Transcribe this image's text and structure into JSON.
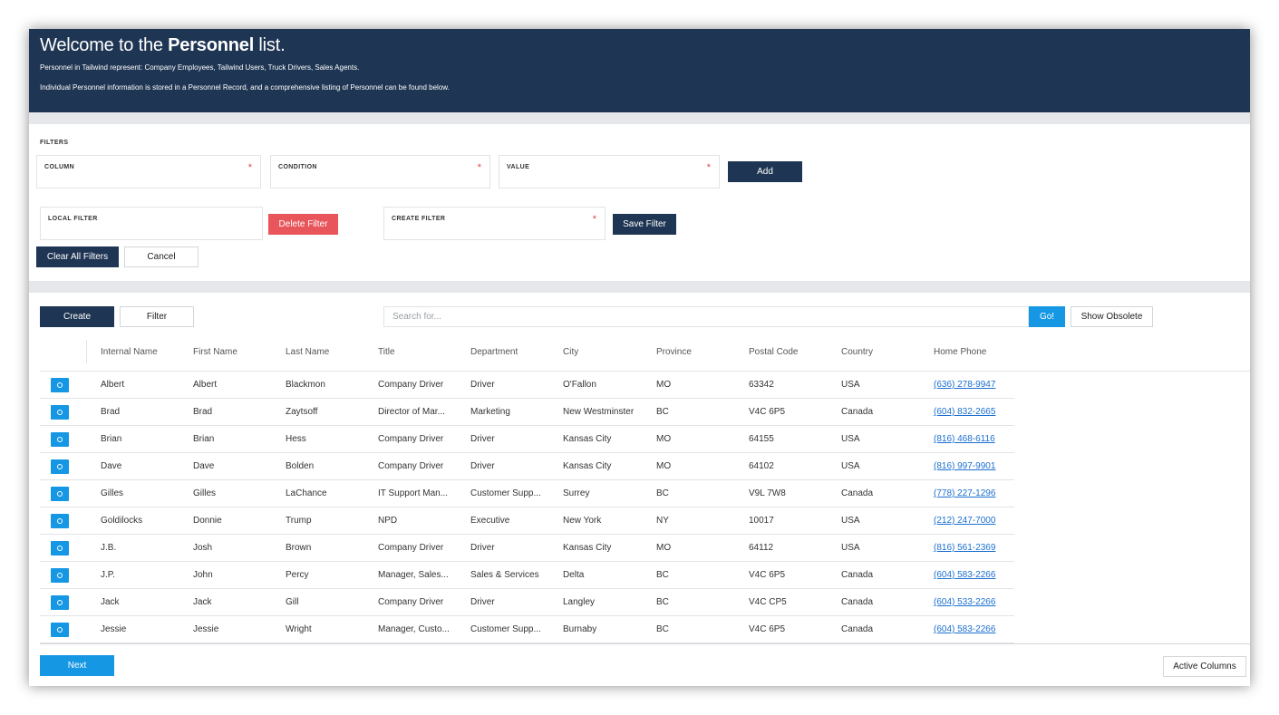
{
  "banner": {
    "title_prefix": "Welcome to the ",
    "title_bold": "Personnel",
    "title_suffix": " list.",
    "line1": "Personnel in Tailwind represent: Company Employees, Tailwind Users, Truck Drivers, Sales Agents.",
    "line2": "Individual Personnel information is stored in a Personnel Record, and a comprehensive listing of Personnel can be found below."
  },
  "filters": {
    "heading": "FILTERS",
    "column_label": "COLUMN",
    "condition_label": "CONDITION",
    "value_label": "VALUE",
    "required_mark": "*",
    "add_label": "Add",
    "local_filter_label": "LOCAL FILTER",
    "delete_filter_label": "Delete Filter",
    "create_filter_label": "CREATE FILTER",
    "save_filter_label": "Save Filter",
    "clear_all_label": "Clear All Filters",
    "cancel_label": "Cancel"
  },
  "toolbar": {
    "create_label": "Create",
    "filter_label": "Filter",
    "search_placeholder": "Search for...",
    "go_label": "Go!",
    "show_obsolete_label": "Show Obsolete"
  },
  "table": {
    "columns": [
      "Internal Name",
      "First Name",
      "Last Name",
      "Title",
      "Department",
      "City",
      "Province",
      "Postal Code",
      "Country",
      "Home Phone"
    ],
    "rows": [
      [
        "Albert",
        "Albert",
        "Blackmon",
        "Company Driver",
        "Driver",
        "O'Fallon",
        "MO",
        "63342",
        "USA",
        "(636) 278-9947"
      ],
      [
        "Brad",
        "Brad",
        "Zaytsoff",
        "Director of Mar...",
        "Marketing",
        "New Westminster",
        "BC",
        "V4C 6P5",
        "Canada",
        "(604) 832-2665"
      ],
      [
        "Brian",
        "Brian",
        "Hess",
        "Company Driver",
        "Driver",
        "Kansas City",
        "MO",
        "64155",
        "USA",
        "(816) 468-6116"
      ],
      [
        "Dave",
        "Dave",
        "Bolden",
        "Company Driver",
        "Driver",
        "Kansas City",
        "MO",
        "64102",
        "USA",
        "(816) 997-9901"
      ],
      [
        "Gilles",
        "Gilles",
        "LaChance",
        "IT Support Man...",
        "Customer Supp...",
        "Surrey",
        "BC",
        "V9L 7W8",
        "Canada",
        "(778) 227-1296"
      ],
      [
        "Goldilocks",
        "Donnie",
        "Trump",
        "NPD",
        "Executive",
        "New York",
        "NY",
        "10017",
        "USA",
        "(212) 247-7000"
      ],
      [
        "J.B.",
        "Josh",
        "Brown",
        "Company Driver",
        "Driver",
        "Kansas City",
        "MO",
        "64112",
        "USA",
        "(816) 561-2369"
      ],
      [
        "J.P.",
        "John",
        "Percy",
        "Manager, Sales...",
        "Sales & Services",
        "Delta",
        "BC",
        "V4C 6P5",
        "Canada",
        "(604) 583-2266"
      ],
      [
        "Jack",
        "Jack",
        "Gill",
        "Company Driver",
        "Driver",
        "Langley",
        "BC",
        "V4C CP5",
        "Canada",
        "(604) 533-2266"
      ],
      [
        "Jessie",
        "Jessie",
        "Wright",
        "Manager, Custo...",
        "Customer Supp...",
        "Burnaby",
        "BC",
        "V4C 6P5",
        "Canada",
        "(604) 583-2266"
      ]
    ]
  },
  "footer": {
    "next_label": "Next",
    "active_columns_label": "Active Columns"
  },
  "colors": {
    "navy": "#1e3553",
    "accent_blue": "#1597e4",
    "danger_red": "#e8555a",
    "link_blue": "#1a6fd0"
  }
}
